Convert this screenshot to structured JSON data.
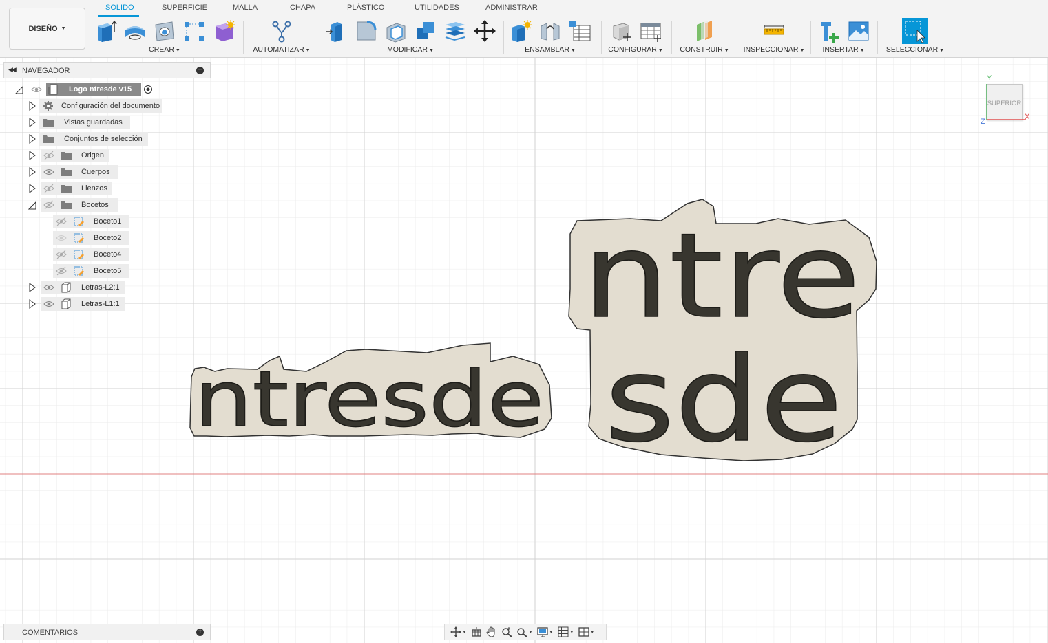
{
  "workspace": {
    "label": "DISEÑO"
  },
  "tabs": [
    "SOLIDO",
    "SUPERFICIE",
    "MALLA",
    "CHAPA",
    "PLÁSTICO",
    "UTILIDADES",
    "ADMINISTRAR"
  ],
  "groups": {
    "crear": "CREAR",
    "automatizar": "AUTOMATIZAR",
    "modificar": "MODIFICAR",
    "ensamblar": "ENSAMBLAR",
    "configurar": "CONFIGURAR",
    "construir": "CONSTRUIR",
    "inspeccionar": "INSPECCIONAR",
    "insertar": "INSERTAR",
    "seleccionar": "SELECCIONAR"
  },
  "browser": {
    "title": "NAVEGADOR",
    "root": "Logo ntresde v15",
    "items": [
      "Configuración del documento",
      "Vistas guardadas",
      "Conjuntos de selección",
      "Origen",
      "Cuerpos",
      "Lienzos",
      "Bocetos",
      "Boceto1",
      "Boceto2",
      "Boceto4",
      "Boceto5",
      "Letras-L2:1",
      "Letras-L1:1"
    ]
  },
  "comments": {
    "title": "COMENTARIOS"
  },
  "viewcube": {
    "face": "SUPERIOR",
    "x": "X",
    "y": "Y",
    "z": "Z"
  },
  "model": {
    "text_wide": "ntresde",
    "text_stacked_top": "ntre",
    "text_stacked_bottom": "sde"
  },
  "colors": {
    "accent": "#0696d7",
    "plate": "#e3ddd0",
    "letters": "#38362f",
    "x_axis": "#e04040",
    "grid": "#dadada"
  }
}
